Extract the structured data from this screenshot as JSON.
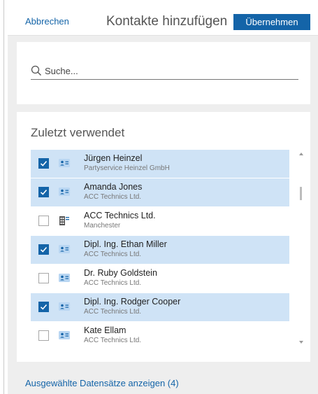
{
  "header": {
    "cancel_label": "Abbrechen",
    "title": "Kontakte hinzufügen",
    "accept_label": "Übernehmen"
  },
  "search": {
    "placeholder": "Suche...",
    "value": ""
  },
  "list": {
    "section_title": "Zuletzt verwendet",
    "items": [
      {
        "name": "Jürgen Heinzel",
        "subtitle": "Partyservice Heinzel GmbH",
        "checked": true,
        "type": "contact-card-icon"
      },
      {
        "name": "Amanda Jones",
        "subtitle": "ACC Technics Ltd.",
        "checked": true,
        "type": "contact-card-icon"
      },
      {
        "name": "ACC Technics Ltd.",
        "subtitle": "Manchester",
        "checked": false,
        "type": "company-building-icon"
      },
      {
        "name": "Dipl. Ing. Ethan Miller",
        "subtitle": "ACC Technics Ltd.",
        "checked": true,
        "type": "contact-card-icon"
      },
      {
        "name": "Dr. Ruby Goldstein",
        "subtitle": "ACC Technics Ltd.",
        "checked": false,
        "type": "contact-card-icon"
      },
      {
        "name": "Dipl. Ing. Rodger Cooper",
        "subtitle": "ACC Technics Ltd.",
        "checked": true,
        "type": "contact-card-icon"
      },
      {
        "name": "Kate Ellam",
        "subtitle": "ACC Technics Ltd.",
        "checked": false,
        "type": "contact-card-icon"
      }
    ]
  },
  "footer": {
    "show_selected_label": "Ausgewählte Datensätze anzeigen (4)"
  },
  "colors": {
    "accent": "#1464a8",
    "selected_row": "#cfe3f6",
    "panel_background": "#eeeeee"
  }
}
